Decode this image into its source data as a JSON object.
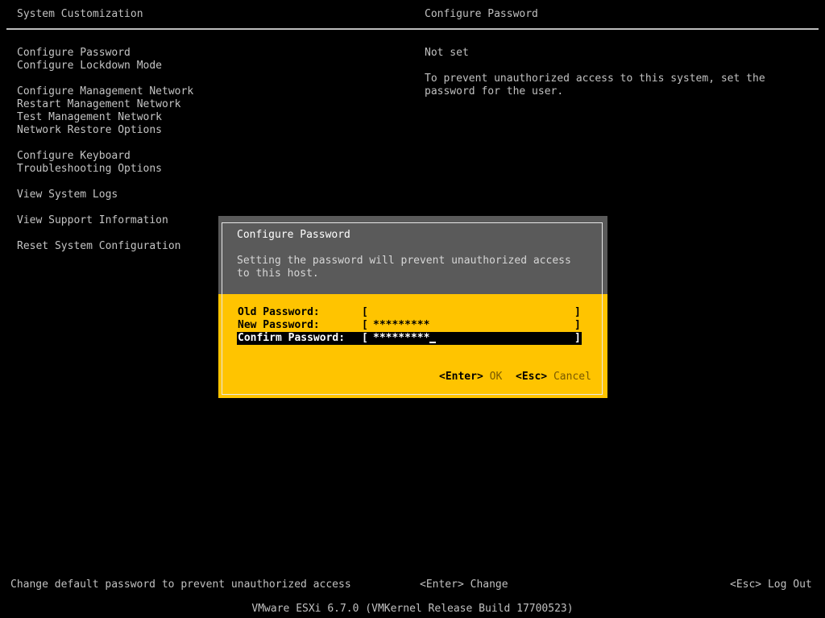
{
  "header": {
    "left_title": "System Customization",
    "right_title": "Configure Password"
  },
  "menu": {
    "items": [
      {
        "label": "Configure Password"
      },
      {
        "label": "Configure Lockdown Mode"
      },
      {
        "label": "Configure Management Network"
      },
      {
        "label": "Restart Management Network"
      },
      {
        "label": "Test Management Network"
      },
      {
        "label": "Network Restore Options"
      },
      {
        "label": "Configure Keyboard"
      },
      {
        "label": "Troubleshooting Options"
      },
      {
        "label": "View System Logs"
      },
      {
        "label": "View Support Information"
      },
      {
        "label": "Reset System Configuration"
      }
    ]
  },
  "detail": {
    "status": "Not set",
    "description": "To prevent unauthorized access to this system, set the\npassword for the user."
  },
  "dialog": {
    "title": "Configure Password",
    "description": "Setting the password will prevent unauthorized access\nto this host.",
    "fields": [
      {
        "label": "Old Password:",
        "open": "[",
        "value": "",
        "close": "]"
      },
      {
        "label": "New Password:",
        "open": "[",
        "value": "*********",
        "close": "]"
      },
      {
        "label": "Confirm Password:",
        "open": "[",
        "value": "*********",
        "close": "]"
      }
    ],
    "ok_key": "<Enter>",
    "ok_label": "OK",
    "cancel_key": "<Esc>",
    "cancel_label": "Cancel"
  },
  "status_bar": {
    "hint": "Change default password to prevent unauthorized access",
    "enter_key": "<Enter>",
    "enter_action": "Change",
    "esc_key": "<Esc>",
    "esc_action": "Log Out"
  },
  "footer": {
    "version": "VMware ESXi 6.7.0 (VMKernel Release Build 17700523)"
  },
  "colors": {
    "background": "#000000",
    "dialog_header": "#5a5a5a",
    "dialog_body": "#ffc400",
    "text": "#c0c0c0"
  }
}
